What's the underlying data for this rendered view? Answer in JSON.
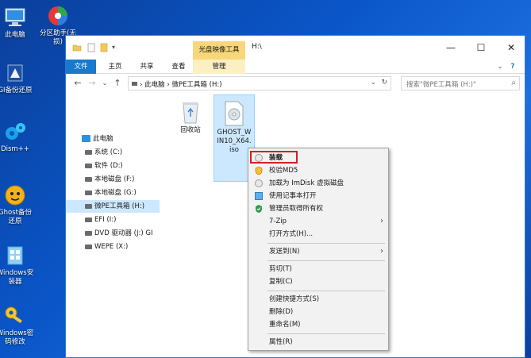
{
  "desktop": {
    "icons": [
      {
        "label": "此电脑",
        "icon": "computer-icon"
      },
      {
        "label": "分区助手(无损)",
        "icon": "partition-tool-icon"
      },
      {
        "label": "GI备份还原",
        "icon": "backup-restore-icon"
      },
      {
        "label": "Dism++",
        "icon": "gears-icon"
      },
      {
        "label": "Ghost备份还原",
        "icon": "ghost-icon"
      },
      {
        "label": "Windows安装器",
        "icon": "windows-installer-icon"
      },
      {
        "label": "Windows密码修改",
        "icon": "key-icon"
      }
    ]
  },
  "window": {
    "context_tab_group": "光盘映像工具",
    "path_title": "H:\\",
    "controls": {
      "minimize": "—",
      "maximize": "☐",
      "close": "✕"
    },
    "ribbon_tabs": [
      "文件",
      "主页",
      "共享",
      "查看",
      "管理"
    ],
    "address": {
      "computer": "此电脑",
      "drive": "微PE工具箱 (H:)"
    },
    "search_placeholder": "搜索\"微PE工具箱 (H:)\""
  },
  "navpane": {
    "items": [
      {
        "label": "此电脑",
        "selected": false
      },
      {
        "label": "系统 (C:)",
        "selected": false
      },
      {
        "label": "软件 (D:)",
        "selected": false
      },
      {
        "label": "本地磁盘 (F:)",
        "selected": false
      },
      {
        "label": "本地磁盘 (G:)",
        "selected": false
      },
      {
        "label": "微PE工具箱 (H:)",
        "selected": true
      },
      {
        "label": "EFI (I:)",
        "selected": false
      },
      {
        "label": "DVD 驱动器 (J:) GI",
        "selected": false
      },
      {
        "label": "WEPE (X:)",
        "selected": false
      }
    ]
  },
  "files": [
    {
      "label": "回收站",
      "icon": "recycle-bin-icon"
    },
    {
      "label": "GHOST_WIN10_X64.iso",
      "icon": "disc-image-icon",
      "selected": true
    }
  ],
  "context_menu": {
    "items": [
      {
        "label": "装载",
        "icon": "disc-icon",
        "bold": true
      },
      {
        "label": "校验MD5",
        "icon": "shield-icon"
      },
      {
        "label": "加载为 ImDisk 虚拟磁盘",
        "icon": "disc-icon"
      },
      {
        "label": "使用记事本打开",
        "icon": "notepad-icon"
      },
      {
        "label": "管理员取得所有权",
        "icon": "shield-check-icon"
      },
      {
        "label": "7-Zip",
        "submenu": true
      },
      {
        "label": "打开方式(H)..."
      },
      {
        "label": "发送到(N)",
        "submenu": true
      },
      {
        "label": "剪切(T)"
      },
      {
        "label": "复制(C)"
      },
      {
        "label": "创建快捷方式(S)"
      },
      {
        "label": "删除(D)"
      },
      {
        "label": "重命名(M)"
      },
      {
        "label": "属性(R)"
      }
    ]
  },
  "colors": {
    "accent": "#1979ca",
    "highlight": "#d81e1e",
    "context_tab": "#f7d779"
  }
}
